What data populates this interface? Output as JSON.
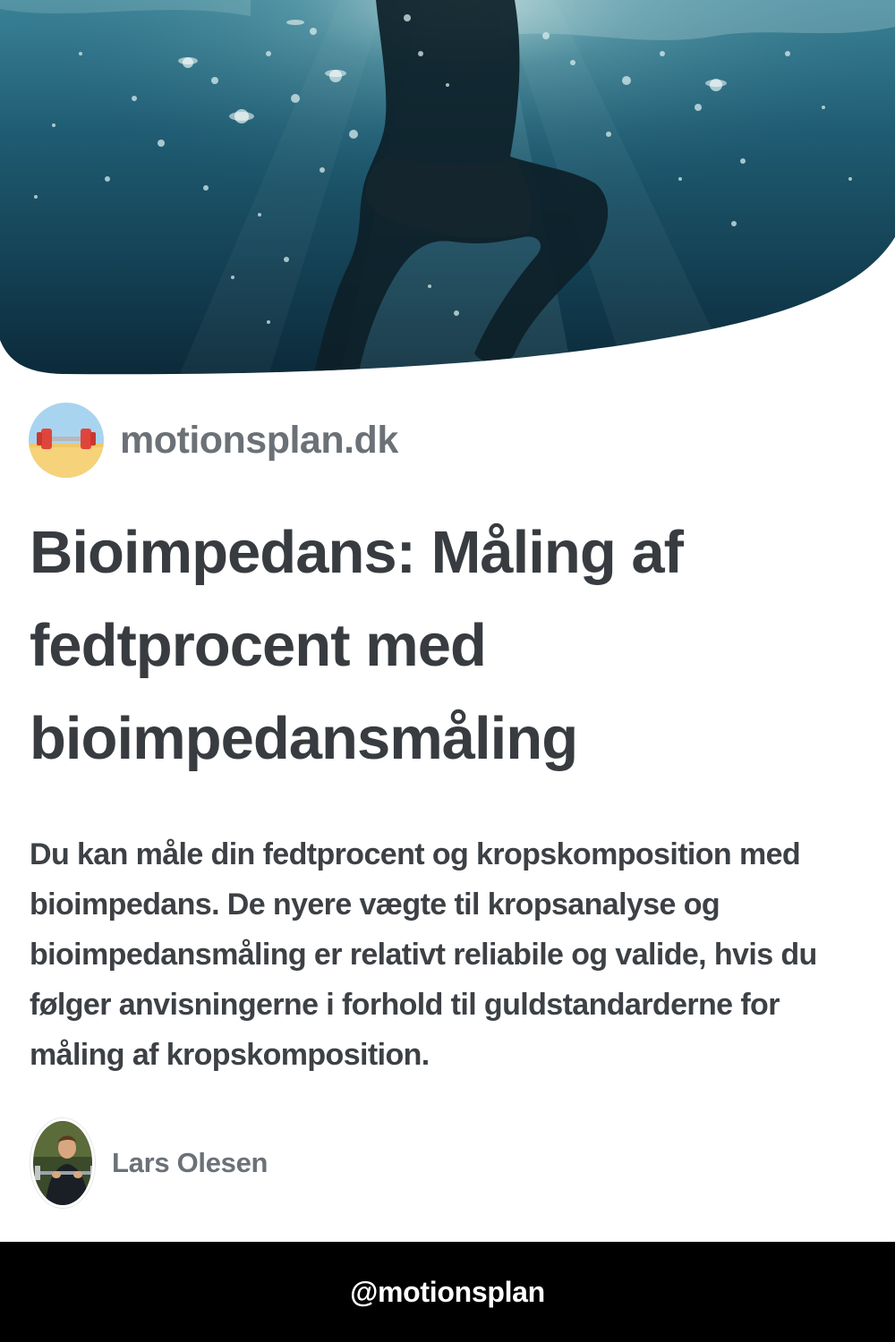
{
  "hero": {
    "image_name": "underwater-swimmer-image"
  },
  "site": {
    "logo_icon": "dumbbell-beach-icon",
    "name": "motionsplan.dk"
  },
  "article": {
    "title": "Bioimpedans: Måling af fedtprocent med bioimpedansmåling",
    "description": "Du kan måle din fedtprocent og kropskomposition med bioimpedans. De nyere vægte til kropsanalyse og bioimpedansmåling er relativt reliabile og valide, hvis du følger anvisningerne i forhold til guldstandarderne for måling af kropskomposition."
  },
  "author": {
    "avatar_icon": "author-photo",
    "name": "Lars Olesen"
  },
  "footer": {
    "handle": "@motionsplan"
  },
  "colors": {
    "title_text": "#383c40",
    "muted_text": "#6b7177",
    "footer_bg": "#000000",
    "water_dark": "#0c2d3e",
    "water_light": "#2f7388"
  }
}
